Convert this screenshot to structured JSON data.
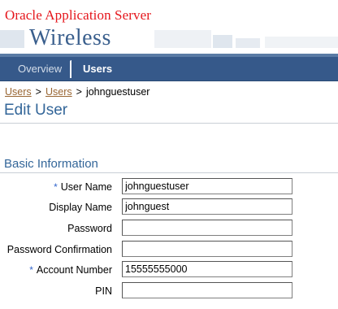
{
  "branding": {
    "company": "Oracle Application Server",
    "product": "Wireless"
  },
  "tabs": [
    {
      "label": "Overview",
      "selected": false
    },
    {
      "label": "Users",
      "selected": true
    }
  ],
  "breadcrumb": {
    "items": [
      "Users",
      "Users"
    ],
    "current": "johnguestuser",
    "separator": ">"
  },
  "page_title": "Edit User",
  "section": {
    "title": "Basic Information"
  },
  "form": {
    "required_marker": "*",
    "fields": [
      {
        "label": "User Name",
        "value": "johnguestuser",
        "required": true
      },
      {
        "label": "Display Name",
        "value": "johnguest",
        "required": false
      },
      {
        "label": "Password",
        "value": "",
        "required": false
      },
      {
        "label": "Password Confirmation",
        "value": "",
        "required": false
      },
      {
        "label": "Account Number",
        "value": "15555555000",
        "required": true
      },
      {
        "label": "PIN",
        "value": "",
        "required": false
      }
    ]
  },
  "colors": {
    "brand_red": "#e5151b",
    "tabbar": "#36598a",
    "heading_blue": "#336699",
    "link_brown": "#996633"
  }
}
